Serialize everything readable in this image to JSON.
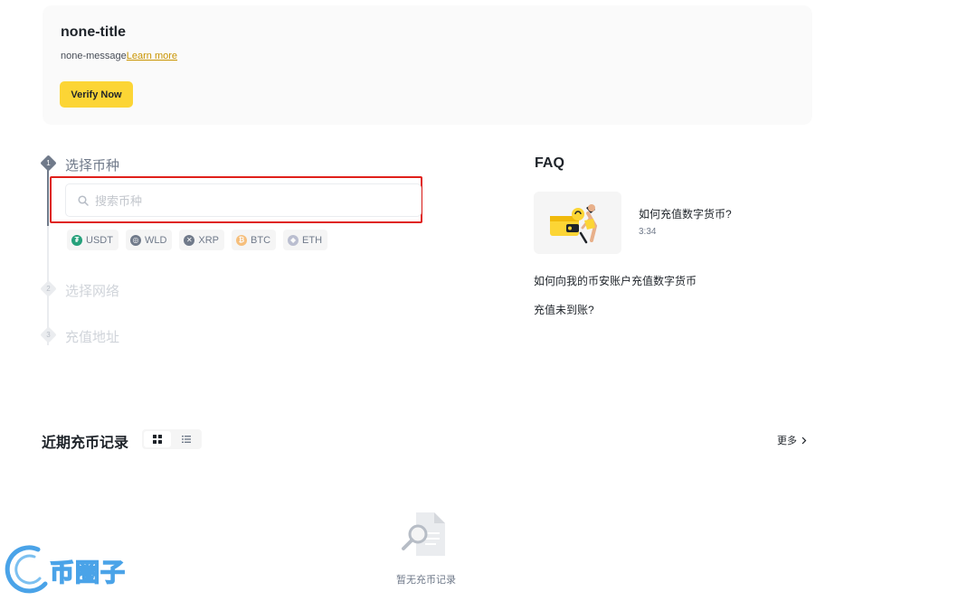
{
  "banner": {
    "title": "none-title",
    "message": "none-message",
    "link_label": "Learn more",
    "button_label": "Verify Now"
  },
  "steps": [
    {
      "number": "1",
      "label": "选择币种"
    },
    {
      "number": "2",
      "label": "选择网络"
    },
    {
      "number": "3",
      "label": "充值地址"
    }
  ],
  "search": {
    "placeholder": "搜索币种",
    "value": ""
  },
  "coins": [
    {
      "symbol": "USDT",
      "icon": "usdt-icon",
      "color": "#26a17b"
    },
    {
      "symbol": "WLD",
      "icon": "wld-icon",
      "color": "#707a8a"
    },
    {
      "symbol": "XRP",
      "icon": "xrp-icon",
      "color": "#707a8a"
    },
    {
      "symbol": "BTC",
      "icon": "btc-icon",
      "color": "#f7931a"
    },
    {
      "symbol": "ETH",
      "icon": "eth-icon",
      "color": "#8a92b2"
    }
  ],
  "faq": {
    "title": "FAQ",
    "video": {
      "title": "如何充值数字货币?",
      "duration": "3:34"
    },
    "links": [
      "如何向我的币安账户充值数字货币",
      "充值未到账?"
    ]
  },
  "records": {
    "title": "近期充币记录",
    "more_label": "更多",
    "empty_text": "暂无充币记录"
  },
  "watermark": {
    "text": "币圈子"
  },
  "colors": {
    "accent": "#fcd535",
    "link": "#c99400",
    "highlight": "#e0201b"
  }
}
